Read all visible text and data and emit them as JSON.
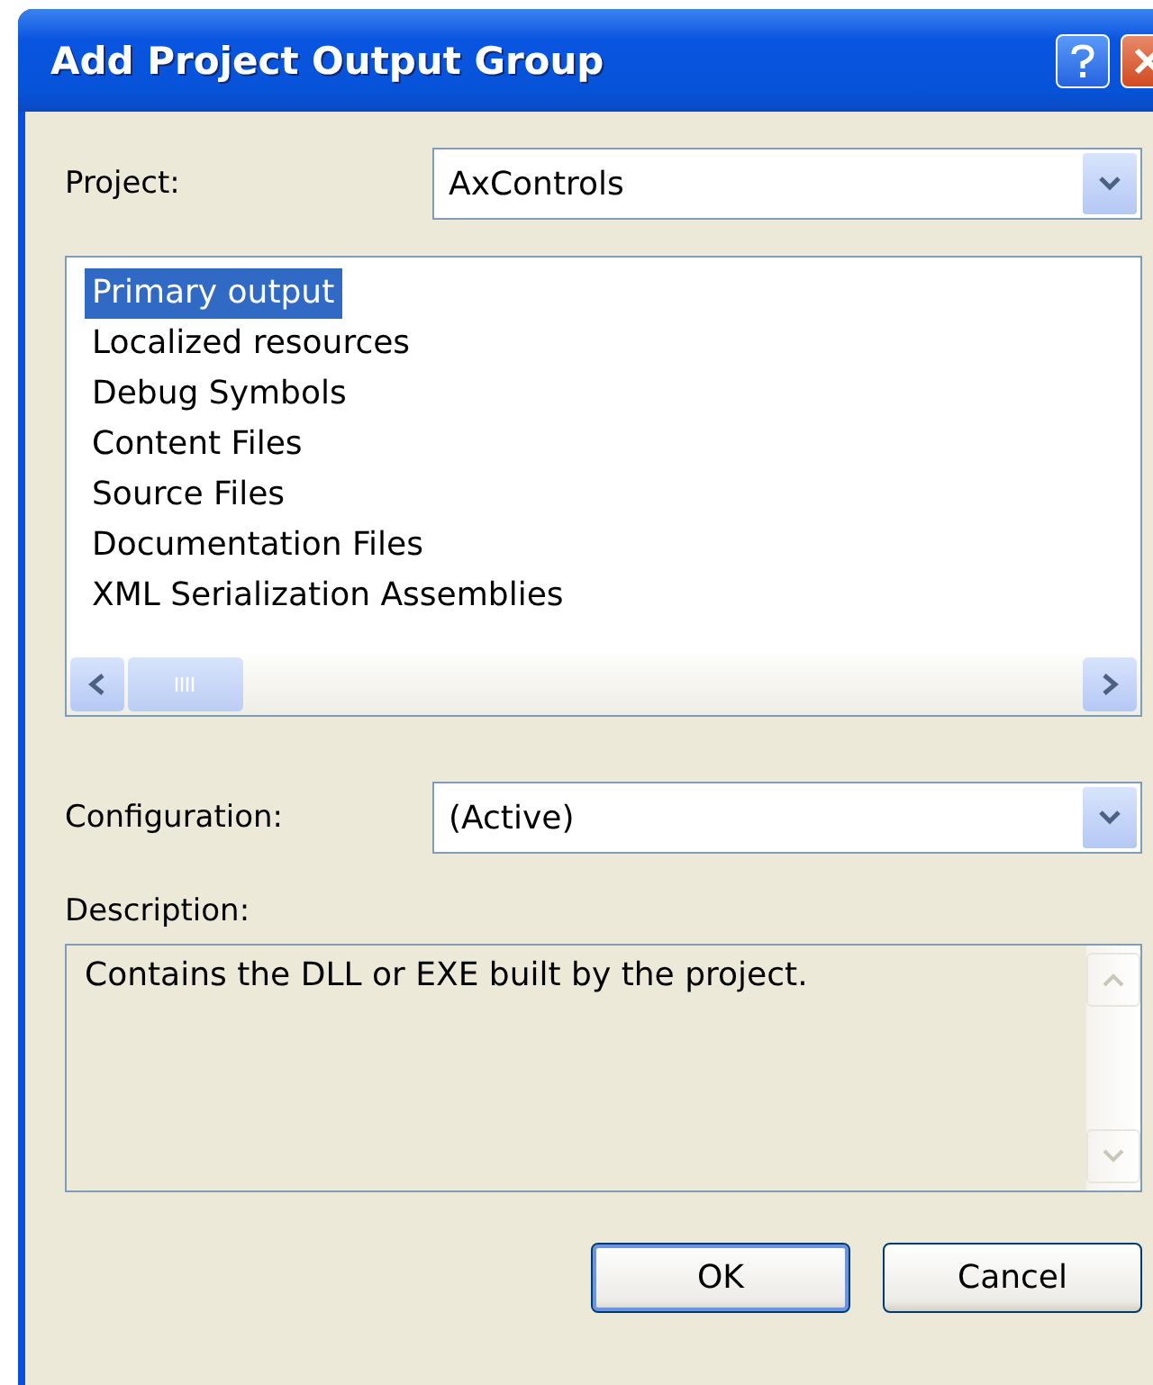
{
  "window": {
    "title": "Add Project Output Group"
  },
  "project": {
    "label": "Project:",
    "value": "AxControls"
  },
  "outputs": [
    {
      "label": "Primary output",
      "selected": true
    },
    {
      "label": "Localized resources",
      "selected": false
    },
    {
      "label": "Debug Symbols",
      "selected": false
    },
    {
      "label": "Content Files",
      "selected": false
    },
    {
      "label": "Source Files",
      "selected": false
    },
    {
      "label": "Documentation Files",
      "selected": false
    },
    {
      "label": "XML Serialization Assemblies",
      "selected": false
    }
  ],
  "configuration": {
    "label": "Configuration:",
    "value": "(Active)"
  },
  "description": {
    "label": "Description:",
    "text": "Contains the DLL or EXE built by the project."
  },
  "buttons": [
    {
      "label": "OK",
      "default": true
    },
    {
      "label": "Cancel",
      "default": false
    }
  ]
}
